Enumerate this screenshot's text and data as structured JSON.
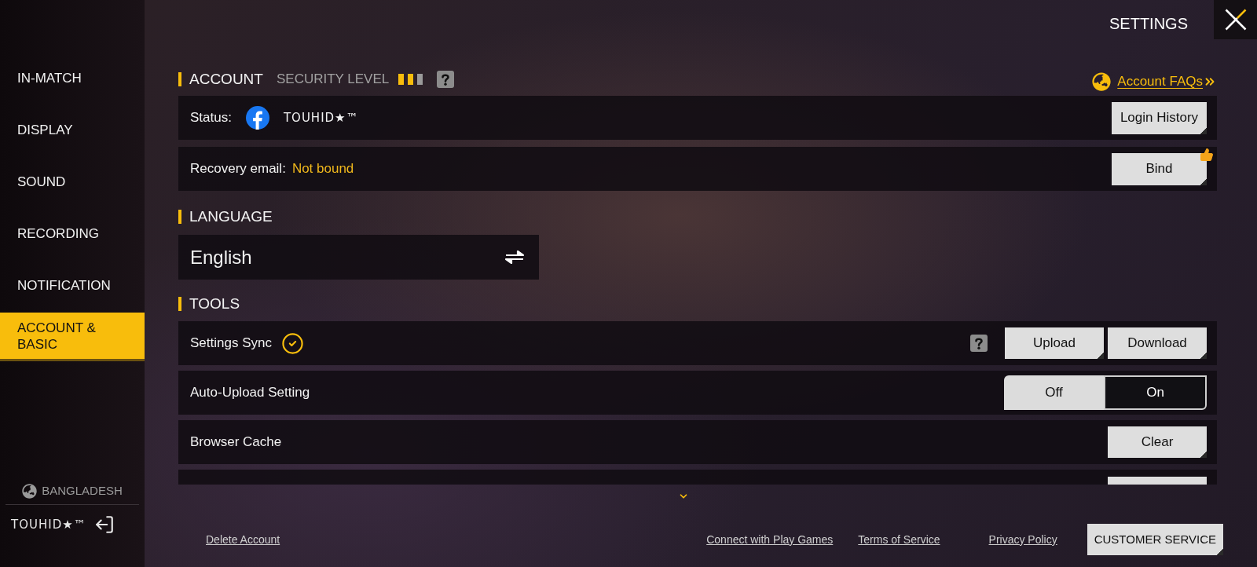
{
  "sidebar": {
    "items": [
      {
        "label": "IN-MATCH",
        "selected": false
      },
      {
        "label": "DISPLAY",
        "selected": false
      },
      {
        "label": "SOUND",
        "selected": false
      },
      {
        "label": "RECORDING",
        "selected": false
      },
      {
        "label": "NOTIFICATION",
        "selected": false
      },
      {
        "label": "ACCOUNT & BASIC",
        "selected": true
      }
    ],
    "region": "BANGLADESH",
    "username": "TOUHID★™"
  },
  "header": {
    "title": "SETTINGS"
  },
  "account": {
    "heading": "ACCOUNT",
    "security_level": {
      "label": "SECURITY LEVEL",
      "level": 0.67
    },
    "faq_link": "Account FAQs",
    "rows": [
      {
        "kind": "status",
        "label": "Status:",
        "value": "TOUHID★™",
        "button": "Login History",
        "recommended": false
      },
      {
        "kind": "recovery",
        "label": "Recovery email:",
        "value": "Not bound",
        "button": "Bind",
        "recommended": true
      }
    ]
  },
  "language": {
    "heading": "LANGUAGE",
    "value": "English"
  },
  "tools": {
    "heading": "TOOLS",
    "rows": [
      {
        "kind": "sync",
        "label": "Settings Sync",
        "synced": true,
        "buttons": [
          "Upload",
          "Download"
        ]
      },
      {
        "kind": "toggle",
        "label": "Auto-Upload Setting",
        "options": [
          {
            "label": "Off",
            "selected": false
          },
          {
            "label": "On",
            "selected": true
          }
        ]
      },
      {
        "kind": "button",
        "label": "Browser Cache",
        "buttons": [
          "Clear"
        ]
      }
    ]
  },
  "footer": {
    "left_link": "Delete Account",
    "links": [
      "Connect with Play Games",
      "Terms of Service",
      "Privacy Policy"
    ],
    "button": "CUSTOMER SERVICE"
  }
}
